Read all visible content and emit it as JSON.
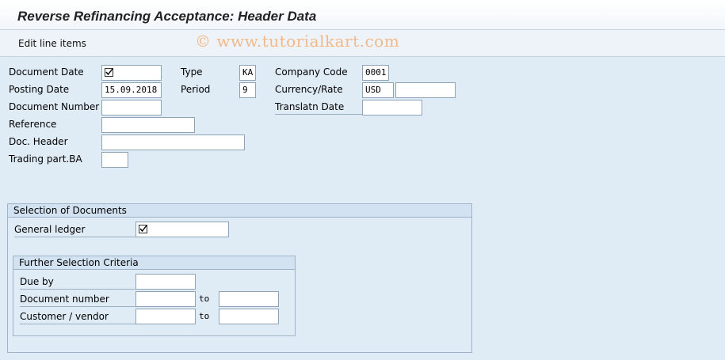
{
  "window": {
    "title": "Reverse Refinancing Acceptance: Header Data"
  },
  "toolbar": {
    "edit_line_items": "Edit line items"
  },
  "watermark": "© www.tutorialkart.com",
  "header": {
    "document_date": {
      "label": "Document Date",
      "value": "",
      "checked": true
    },
    "posting_date": {
      "label": "Posting Date",
      "value": "15.09.2018"
    },
    "document_number": {
      "label": "Document Number",
      "value": ""
    },
    "reference": {
      "label": "Reference",
      "value": ""
    },
    "doc_header": {
      "label": "Doc. Header",
      "value": ""
    },
    "trading_part_ba": {
      "label": "Trading part.BA",
      "value": ""
    },
    "type": {
      "label": "Type",
      "value": "KA"
    },
    "period": {
      "label": "Period",
      "value": "9"
    },
    "company_code": {
      "label": "Company Code",
      "value": "0001"
    },
    "currency_rate": {
      "label": "Currency/Rate",
      "currency": "USD",
      "rate": ""
    },
    "translatn_date": {
      "label": "Translatn Date",
      "value": ""
    }
  },
  "selection": {
    "title": "Selection of Documents",
    "general_ledger": {
      "label": "General ledger",
      "checked": true
    },
    "further": {
      "title": "Further Selection Criteria",
      "to_label": "to",
      "due_by": {
        "label": "Due by",
        "value": ""
      },
      "document_number": {
        "label": "Document number",
        "from": "",
        "to": ""
      },
      "customer_vendor": {
        "label": "Customer / vendor",
        "from": "",
        "to": ""
      }
    }
  }
}
